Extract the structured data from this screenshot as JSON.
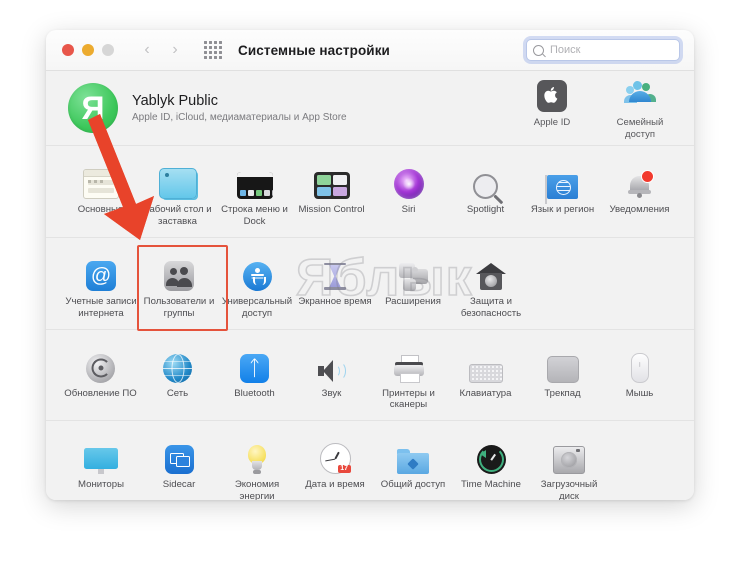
{
  "window": {
    "title": "Системные настройки",
    "traffic_lights": [
      "close",
      "minimize",
      "zoom"
    ],
    "nav_back": "‹",
    "nav_forward": "›",
    "grid_icon": "grid-view-icon"
  },
  "search": {
    "placeholder": "Поиск",
    "value": "",
    "icon": "search-icon"
  },
  "account": {
    "avatar_letter": "Я",
    "name": "Yablyk Public",
    "subtitle": "Apple ID, iCloud, медиаматериалы и App Store",
    "shortcuts": [
      {
        "label": "Apple ID",
        "icon": "apple-id-icon",
        "glyph": ""
      },
      {
        "label": "Семейный доступ",
        "icon": "family-sharing-icon"
      }
    ]
  },
  "sections": [
    {
      "name": "row-1",
      "items": [
        {
          "label": "Основные",
          "icon": "general-icon"
        },
        {
          "label": "Рабочий стол и заставка",
          "icon": "desktop-screensaver-icon"
        },
        {
          "label": "Строка меню и Dock",
          "icon": "menubar-dock-icon"
        },
        {
          "label": "Mission Control",
          "icon": "mission-control-icon"
        },
        {
          "label": "Siri",
          "icon": "siri-icon"
        },
        {
          "label": "Spotlight",
          "icon": "spotlight-icon"
        },
        {
          "label": "Язык и регион",
          "icon": "language-region-icon"
        },
        {
          "label": "Уведомления",
          "icon": "notifications-icon"
        }
      ]
    },
    {
      "name": "row-2",
      "items": [
        {
          "label": "Учетные записи интернета",
          "icon": "internet-accounts-icon"
        },
        {
          "label": "Пользователи и группы",
          "icon": "users-groups-icon"
        },
        {
          "label": "Универсальный доступ",
          "icon": "accessibility-icon"
        },
        {
          "label": "Экранное время",
          "icon": "screen-time-icon"
        },
        {
          "label": "Расширения",
          "icon": "extensions-icon"
        },
        {
          "label": "Защита и безопасность",
          "icon": "security-privacy-icon"
        }
      ]
    },
    {
      "name": "row-3",
      "items": [
        {
          "label": "Обновление ПО",
          "icon": "software-update-icon"
        },
        {
          "label": "Сеть",
          "icon": "network-icon"
        },
        {
          "label": "Bluetooth",
          "icon": "bluetooth-icon"
        },
        {
          "label": "Звук",
          "icon": "sound-icon"
        },
        {
          "label": "Принтеры и сканеры",
          "icon": "printers-scanners-icon"
        },
        {
          "label": "Клавиатура",
          "icon": "keyboard-icon"
        },
        {
          "label": "Трекпад",
          "icon": "trackpad-icon"
        },
        {
          "label": "Мышь",
          "icon": "mouse-icon"
        }
      ]
    },
    {
      "name": "row-4",
      "items": [
        {
          "label": "Мониторы",
          "icon": "displays-icon"
        },
        {
          "label": "Sidecar",
          "icon": "sidecar-icon"
        },
        {
          "label": "Экономия энергии",
          "icon": "energy-saver-icon"
        },
        {
          "label": "Дата и время",
          "icon": "date-time-icon",
          "badge": "17"
        },
        {
          "label": "Общий доступ",
          "icon": "sharing-icon"
        },
        {
          "label": "Time Machine",
          "icon": "time-machine-icon"
        },
        {
          "label": "Загрузочный диск",
          "icon": "startup-disk-icon"
        }
      ]
    }
  ],
  "annotations": {
    "arrow_color": "#e8432a",
    "highlight_color": "#e5533c",
    "highlight_target": "Пользователи и группы",
    "watermark_text": "Яблык"
  }
}
